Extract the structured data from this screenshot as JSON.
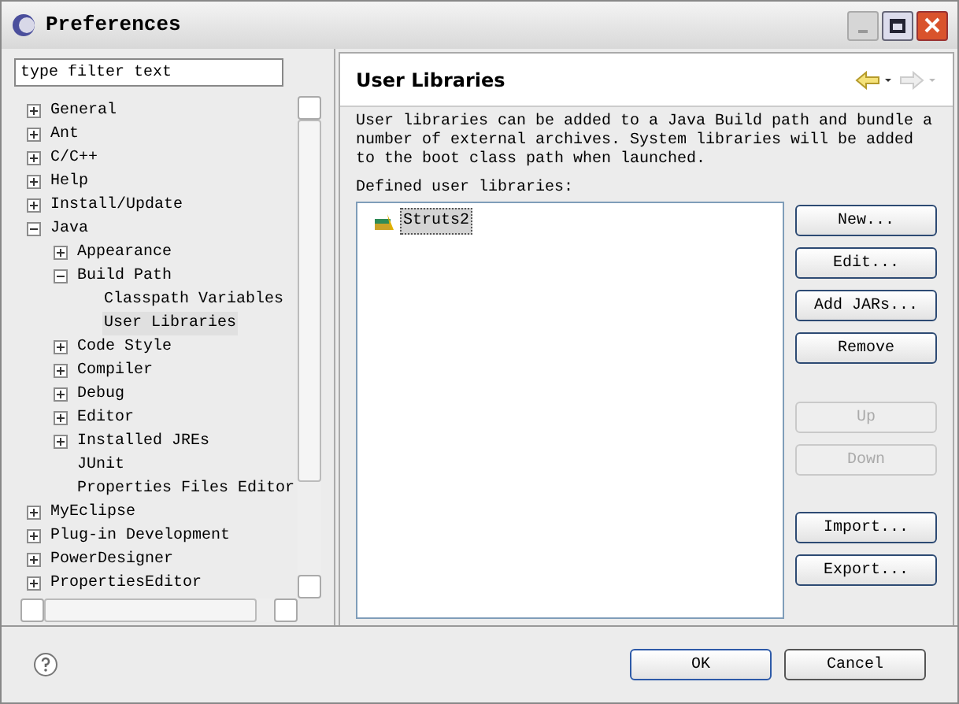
{
  "window": {
    "title": "Preferences"
  },
  "filter": {
    "placeholder": "type filter text"
  },
  "tree": [
    {
      "label": "General",
      "expanded": false,
      "selected": false
    },
    {
      "label": "Ant",
      "expanded": false,
      "selected": false
    },
    {
      "label": "C/C++",
      "expanded": false,
      "selected": false
    },
    {
      "label": "Help",
      "expanded": false,
      "selected": false
    },
    {
      "label": "Install/Update",
      "expanded": false,
      "selected": false
    },
    {
      "label": "Java",
      "expanded": true,
      "selected": false,
      "children": [
        {
          "label": "Appearance",
          "expanded": false,
          "selected": false
        },
        {
          "label": "Build Path",
          "expanded": true,
          "selected": false,
          "children": [
            {
              "label": "Classpath Variables",
              "selected": false
            },
            {
              "label": "User Libraries",
              "selected": true
            }
          ]
        },
        {
          "label": "Code Style",
          "expanded": false,
          "selected": false
        },
        {
          "label": "Compiler",
          "expanded": false,
          "selected": false
        },
        {
          "label": "Debug",
          "expanded": false,
          "selected": false
        },
        {
          "label": "Editor",
          "expanded": false,
          "selected": false
        },
        {
          "label": "Installed JREs",
          "expanded": false,
          "selected": false
        },
        {
          "label": "JUnit",
          "selected": false
        },
        {
          "label": "Properties Files Editor",
          "selected": false
        }
      ]
    },
    {
      "label": "MyEclipse",
      "expanded": false,
      "selected": false
    },
    {
      "label": "Plug-in Development",
      "expanded": false,
      "selected": false
    },
    {
      "label": "PowerDesigner",
      "expanded": false,
      "selected": false
    },
    {
      "label": "PropertiesEditor",
      "expanded": false,
      "selected": false
    }
  ],
  "page": {
    "title": "User Libraries",
    "description": "User libraries can be added to a Java Build path and bundle a number of external archives. System libraries will be added to the boot class path when launched.",
    "list_label": "Defined user libraries:",
    "libraries": [
      {
        "label": "Struts2",
        "selected": true
      }
    ],
    "buttons": [
      {
        "label": "New...",
        "disabled": false
      },
      {
        "label": "Edit...",
        "disabled": false
      },
      {
        "label": "Add JARs...",
        "disabled": false
      },
      {
        "label": "Remove",
        "disabled": false
      },
      {
        "label": "Up",
        "disabled": true
      },
      {
        "label": "Down",
        "disabled": true
      },
      {
        "label": "Import...",
        "disabled": false
      },
      {
        "label": "Export...",
        "disabled": false
      }
    ]
  },
  "footer_buttons": [
    "OK",
    "Cancel"
  ]
}
